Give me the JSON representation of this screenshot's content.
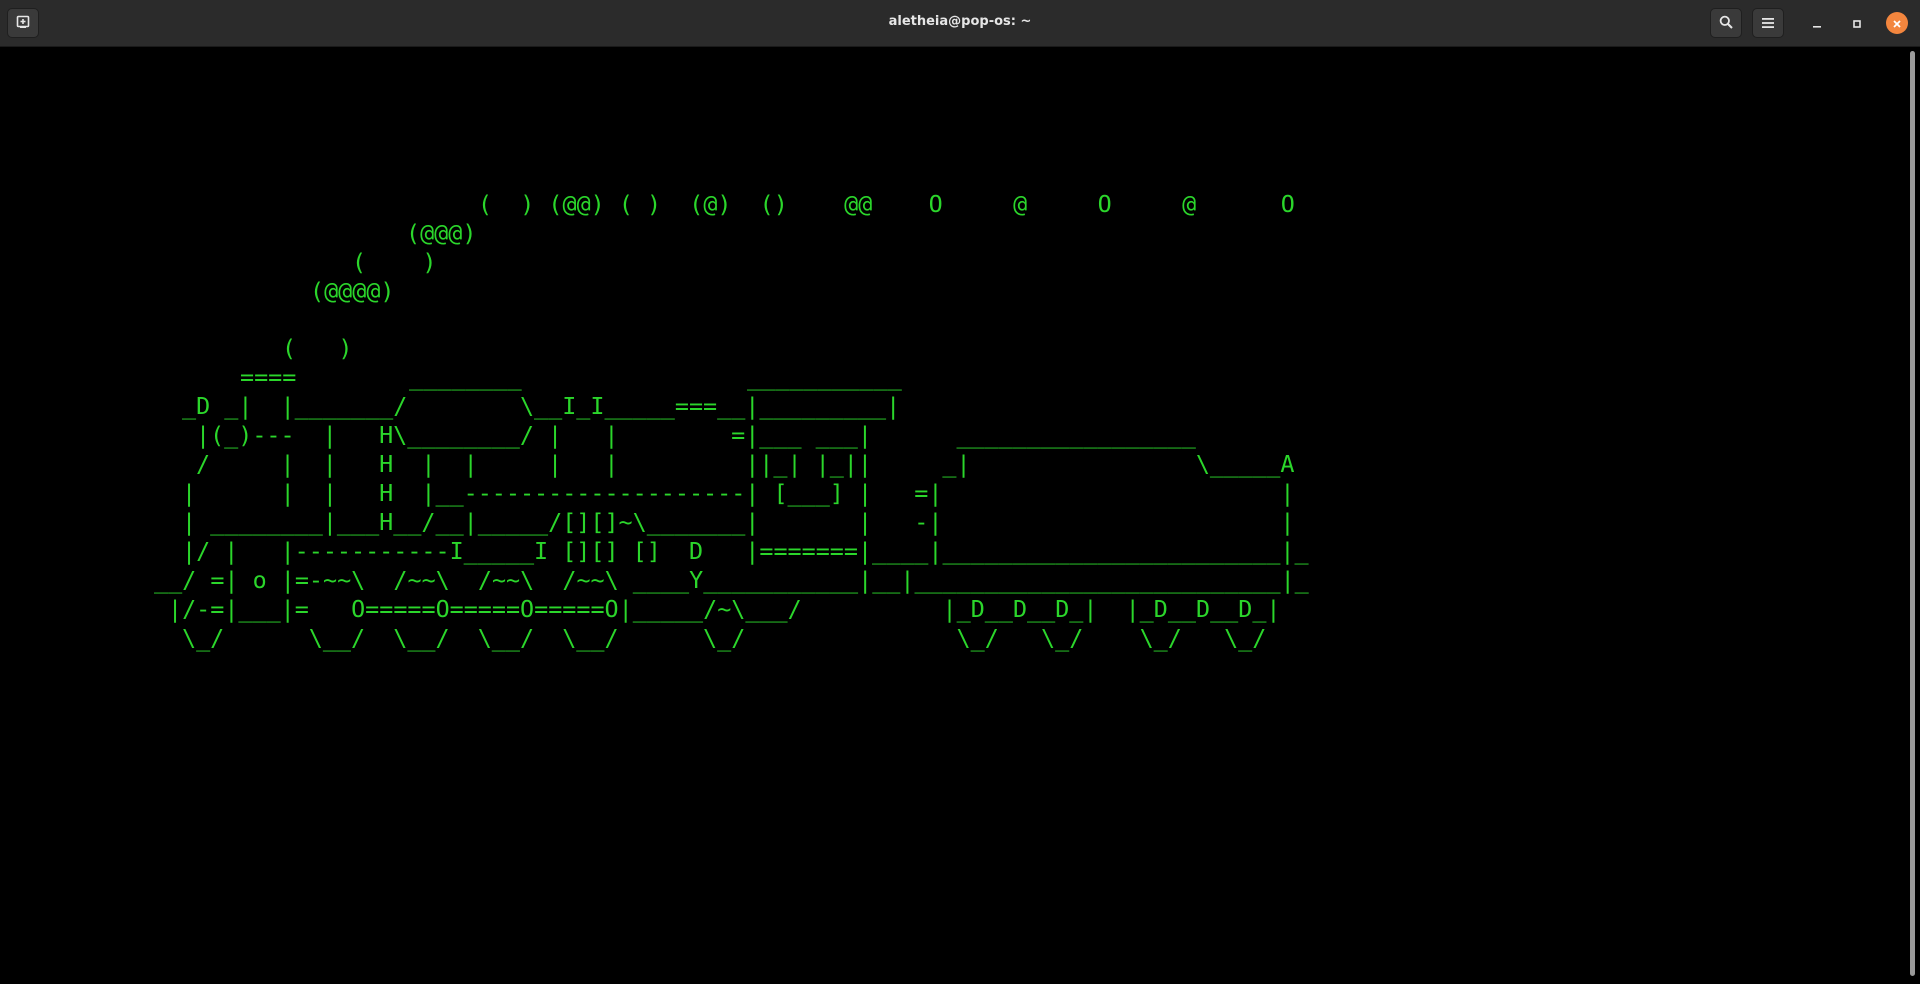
{
  "window": {
    "title": "aletheia@pop-os: ~"
  },
  "icons": {
    "new_tab": "new-tab-icon",
    "search": "search-icon",
    "menu": "hamburger-menu-icon",
    "minimize": "minimize-icon",
    "maximize": "maximize-icon",
    "close": "close-icon"
  },
  "colors": {
    "terminal_bg": "#000000",
    "terminal_fg": "#2bd62b",
    "titlebar_bg": "#2b2b2b",
    "close_accent": "#f3863e"
  },
  "terminal": {
    "smoke": [
      "(  ) (@@) ( )  (@)  ()    @@    O     @     O     @      O",
      "(@@@)",
      "(    )",
      "(@@@@)",
      "(   )"
    ],
    "train": [
      "====        ________                ___________",
      "_D _|  |_______/        \\__I_I_____===__|_________|",
      "|(_)---  |   H\\________/ |   |        =|___ ___|      _________________",
      "/     |  |   H  |  |     |   |         ||_| |_||     _|                \\_____A",
      "|      |  |   H  |__--------------------| [___] |   =|                        |",
      "| ________|___H__/__|_____/[][]~\\_______|       |   -|                        |",
      "|/ |   |-----------I_____I [][] []  D   |=======|____|________________________|_",
      "__/ =| o |=-~~\\  /~~\\  /~~\\  /~~\\ ____Y___________|__|__________________________|_",
      "|/-=|___|=   O=====O=====O=====O|_____/~\\___/          |_D__D__D_|  |_D__D__D_|",
      "\\_/      \\__/  \\__/  \\__/  \\__/      \\_/               \\_/   \\_/    \\_/   \\_/"
    ]
  }
}
